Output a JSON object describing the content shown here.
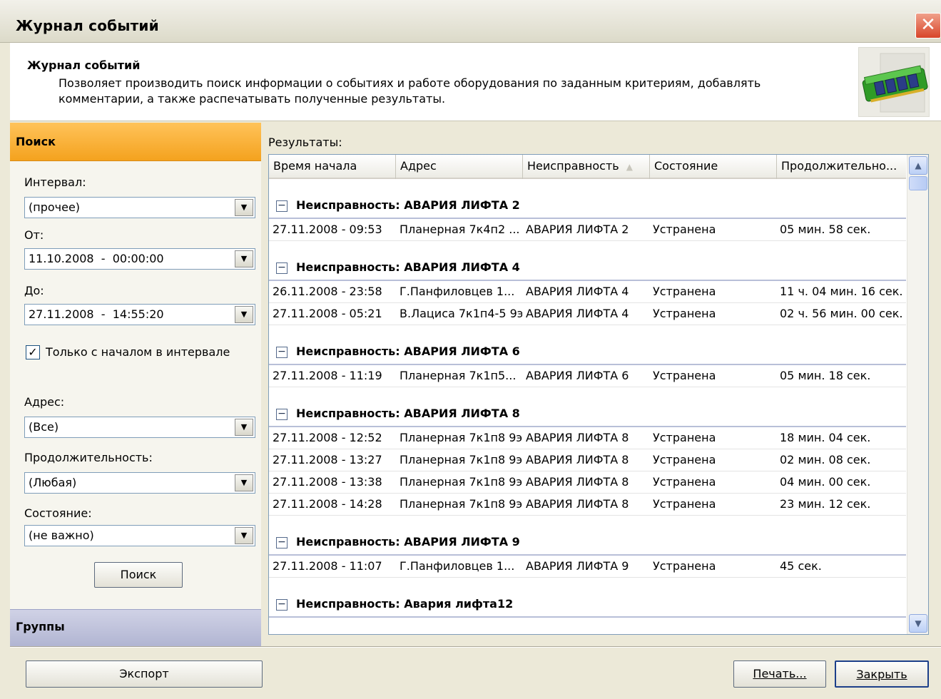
{
  "window": {
    "title": "Журнал событий",
    "close_glyph": "✕"
  },
  "header": {
    "title": "Журнал событий",
    "description": "Позволяет производить поиск информации о событиях и работе оборудования по заданным критериям, добавлять комментарии, а также распечатывать полученные результаты.",
    "icon": "memory-module-icon"
  },
  "left_panel": {
    "search_section": "Поиск",
    "groups_section": "Группы",
    "interval_label": "Интервал:",
    "interval_value": "(прочее)",
    "from_label": "От:",
    "from_value": "11.10.2008  -  00:00:00",
    "to_label": "До:",
    "to_value": "27.11.2008  -  14:55:20",
    "only_start_checkbox_label": "Только с началом в интервале",
    "only_start_checked": true,
    "address_label": "Адрес:",
    "address_value": "(Все)",
    "duration_label": "Продолжительность:",
    "duration_value": "(Любая)",
    "state_label": "Состояние:",
    "state_value": "(не важно)",
    "search_button": "Поиск"
  },
  "results": {
    "label": "Результаты:",
    "columns": [
      "Время начала",
      "Адрес",
      "Неисправность",
      "Состояние",
      "Продолжительно..."
    ],
    "groups": [
      {
        "title": "Неисправность: АВАРИЯ ЛИФТА 2",
        "rows": [
          [
            "27.11.2008 - 09:53",
            "Планерная 7к4п2 ...",
            "АВАРИЯ ЛИФТА 2",
            "Устранена",
            "05 мин. 58 сек."
          ]
        ]
      },
      {
        "title": "Неисправность: АВАРИЯ ЛИФТА 4",
        "rows": [
          [
            "26.11.2008 - 23:58",
            "Г.Панфиловцев 1...",
            "АВАРИЯ ЛИФТА 4",
            "Устранена",
            "11 ч. 04 мин. 16 сек."
          ],
          [
            "27.11.2008 - 05:21",
            "В.Лациса 7к1п4-5 9э",
            "АВАРИЯ ЛИФТА 4",
            "Устранена",
            "02 ч. 56 мин. 00 сек."
          ]
        ]
      },
      {
        "title": "Неисправность: АВАРИЯ ЛИФТА 6",
        "rows": [
          [
            "27.11.2008 - 11:19",
            "Планерная 7к1п5...",
            "АВАРИЯ ЛИФТА 6",
            "Устранена",
            "05 мин. 18 сек."
          ]
        ]
      },
      {
        "title": "Неисправность: АВАРИЯ ЛИФТА 8",
        "rows": [
          [
            "27.11.2008 - 12:52",
            "Планерная 7к1п8 9э",
            "АВАРИЯ ЛИФТА 8",
            "Устранена",
            "18 мин. 04 сек."
          ],
          [
            "27.11.2008 - 13:27",
            "Планерная 7к1п8 9э",
            "АВАРИЯ ЛИФТА 8",
            "Устранена",
            "02 мин. 08 сек."
          ],
          [
            "27.11.2008 - 13:38",
            "Планерная 7к1п8 9э",
            "АВАРИЯ ЛИФТА 8",
            "Устранена",
            "04 мин. 00 сек."
          ],
          [
            "27.11.2008 - 14:28",
            "Планерная 7к1п8 9э",
            "АВАРИЯ ЛИФТА 8",
            "Устранена",
            "23 мин. 12 сек."
          ]
        ]
      },
      {
        "title": "Неисправность: АВАРИЯ ЛИФТА 9",
        "rows": [
          [
            "27.11.2008 - 11:07",
            "Г.Панфиловцев 1...",
            "АВАРИЯ ЛИФТА 9",
            "Устранена",
            "45 сек."
          ]
        ]
      },
      {
        "title": "Неисправность: Авария лифта12",
        "rows": []
      }
    ]
  },
  "footer": {
    "export_button": "Экспорт",
    "print_button": "Печать...",
    "close_button": "Закрыть"
  },
  "colors": {
    "search_header": "#f4a21e",
    "groups_header": "#b1b5d2",
    "window_bg": "#ece9d8",
    "close_button": "#d8452a"
  }
}
